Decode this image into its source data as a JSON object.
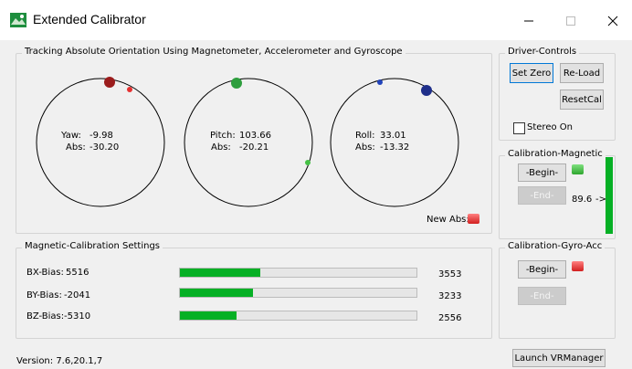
{
  "window": {
    "title": "Extended Calibrator"
  },
  "orientation": {
    "group_label": "Tracking Absolute Orientation Using Magnetometer, Accelerometer and Gyroscope",
    "yaw": {
      "label": "Yaw:",
      "value": "-9.98",
      "abs_label": "Abs:",
      "abs_value": "-30.20"
    },
    "pitch": {
      "label": "Pitch:",
      "value": "103.66",
      "abs_label": "Abs:",
      "abs_value": "-20.21"
    },
    "roll": {
      "label": "Roll:",
      "value": "33.01",
      "abs_label": "Abs:",
      "abs_value": "-13.32"
    },
    "new_abs_label": "New Abs:"
  },
  "driver": {
    "group_label": "Driver-Controls",
    "set_zero": "Set Zero",
    "reload": "Re-Load",
    "reset_cal": "ResetCal",
    "stereo_label": "Stereo On",
    "stereo_checked": false
  },
  "cal_mag": {
    "group_label": "Calibration-Magnetic",
    "begin": "-Begin-",
    "end": "-End-",
    "value": "89.6",
    "arrow": "->",
    "led": "green"
  },
  "mag_settings": {
    "group_label": "Magnetic-Calibration Settings",
    "rows": [
      {
        "label": "BX-Bias:",
        "value": "5516",
        "target": "3553",
        "progress": 0.34
      },
      {
        "label": "BY-Bias:",
        "value": "-2041",
        "target": "3233",
        "progress": 0.31
      },
      {
        "label": "BZ-Bias:",
        "value": "-5310",
        "target": "2556",
        "progress": 0.24
      }
    ]
  },
  "cal_gyro": {
    "group_label": "Calibration-Gyro-Acc",
    "begin": "-Begin-",
    "end": "-End-",
    "led": "red"
  },
  "footer": {
    "version": "Version: 7.6,20.1,7",
    "launch": "Launch VRManager"
  },
  "colors": {
    "yaw_dot": "#9b1c1c",
    "yaw_small": "#e53030",
    "pitch_dot": "#2e9e3e",
    "pitch_small": "#45c045",
    "roll_dot": "#1f2f8a",
    "roll_small": "#2244bb",
    "progress": "#06b025"
  }
}
